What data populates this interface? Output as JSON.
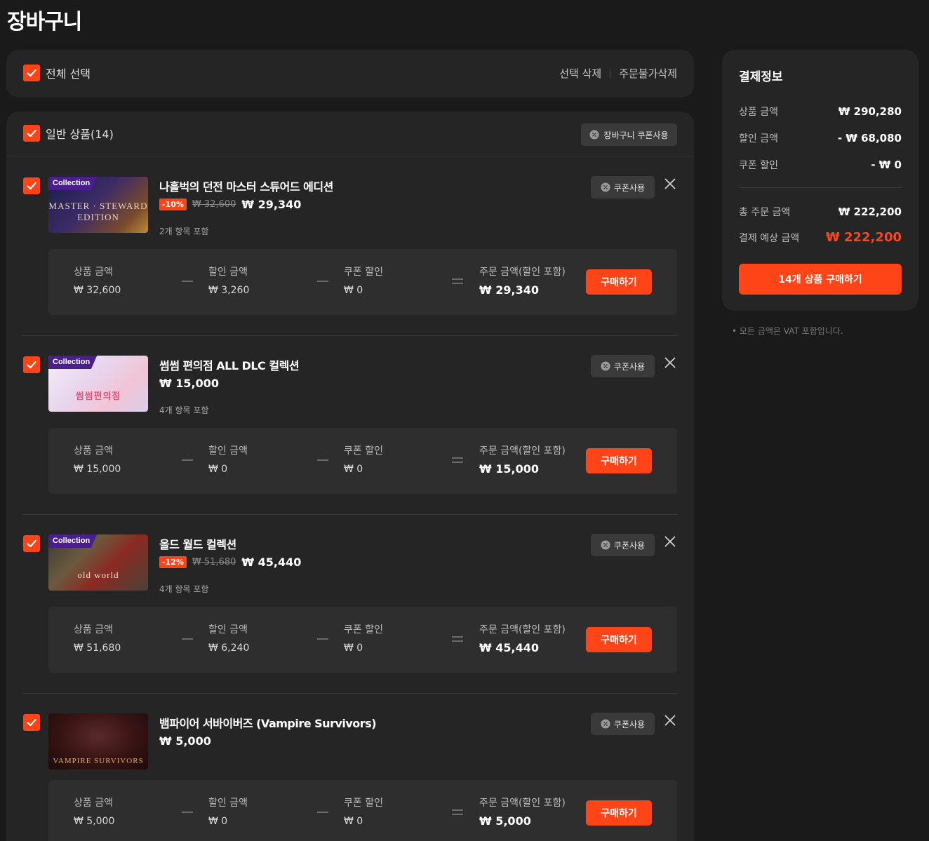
{
  "page": {
    "title": "장바구니"
  },
  "select_all": {
    "label": "전체 선택",
    "delete_selected": "선택 삭제",
    "delete_unavailable": "주문불가삭제"
  },
  "cart": {
    "section_label": "일반 상품(14)",
    "cart_coupon_label": "장바구니 쿠폰사용",
    "coupon_label": "쿠폰사용",
    "buy_label": "구매하기",
    "col_labels": {
      "product": "상품 금액",
      "discount": "할인 금액",
      "coupon": "쿠폰 할인",
      "order": "주문 금액(할인 포함)"
    },
    "items": [
      {
        "badge": "Collection",
        "art": "MASTER · STEWARD EDITION",
        "title": "나흘벅의 던전 마스터 스튜어드 에디션",
        "discount": "-10%",
        "original": "₩ 32,600",
        "price": "₩ 29,340",
        "includes": "2개 항목 포함",
        "product_amount": "₩ 32,600",
        "discount_amount": "₩ 3,260",
        "coupon_amount": "₩ 0",
        "order_amount": "₩ 29,340"
      },
      {
        "badge": "Collection",
        "art": "썸썸편의점",
        "title": "썸썸 편의점 ALL DLC 컬렉션",
        "discount": "",
        "original": "",
        "price": "₩ 15,000",
        "includes": "4개 항목 포함",
        "product_amount": "₩ 15,000",
        "discount_amount": "₩ 0",
        "coupon_amount": "₩ 0",
        "order_amount": "₩ 15,000"
      },
      {
        "badge": "Collection",
        "art": "old world",
        "title": "올드 월드 컬렉션",
        "discount": "-12%",
        "original": "₩ 51,680",
        "price": "₩ 45,440",
        "includes": "4개 항목 포함",
        "product_amount": "₩ 51,680",
        "discount_amount": "₩ 6,240",
        "coupon_amount": "₩ 0",
        "order_amount": "₩ 45,440"
      },
      {
        "badge": "",
        "art": "VAMPIRE SURVIVORS",
        "title": "뱀파이어 서바이버즈 (Vampire Survivors)",
        "discount": "",
        "original": "",
        "price": "₩ 5,000",
        "includes": "",
        "product_amount": "₩ 5,000",
        "discount_amount": "₩ 0",
        "coupon_amount": "₩ 0",
        "order_amount": "₩ 5,000"
      }
    ]
  },
  "summary": {
    "title": "결제정보",
    "rows": [
      {
        "label": "상품 금액",
        "value": "₩ 290,280"
      },
      {
        "label": "할인 금액",
        "value": "- ₩ 68,080"
      },
      {
        "label": "쿠폰 할인",
        "value": "- ₩ 0"
      }
    ],
    "total_label": "총 주문 금액",
    "total_value": "₩ 222,200",
    "expected_label": "결제 예상 금액",
    "expected_value": "₩ 222,200",
    "buy_all_label": "14개 상품 구매하기",
    "vat_note": "• 모든 금액은 VAT 포함입니다."
  },
  "colors": {
    "accent": "#ff4418",
    "panel": "#252525",
    "background": "#1a1a1a"
  }
}
